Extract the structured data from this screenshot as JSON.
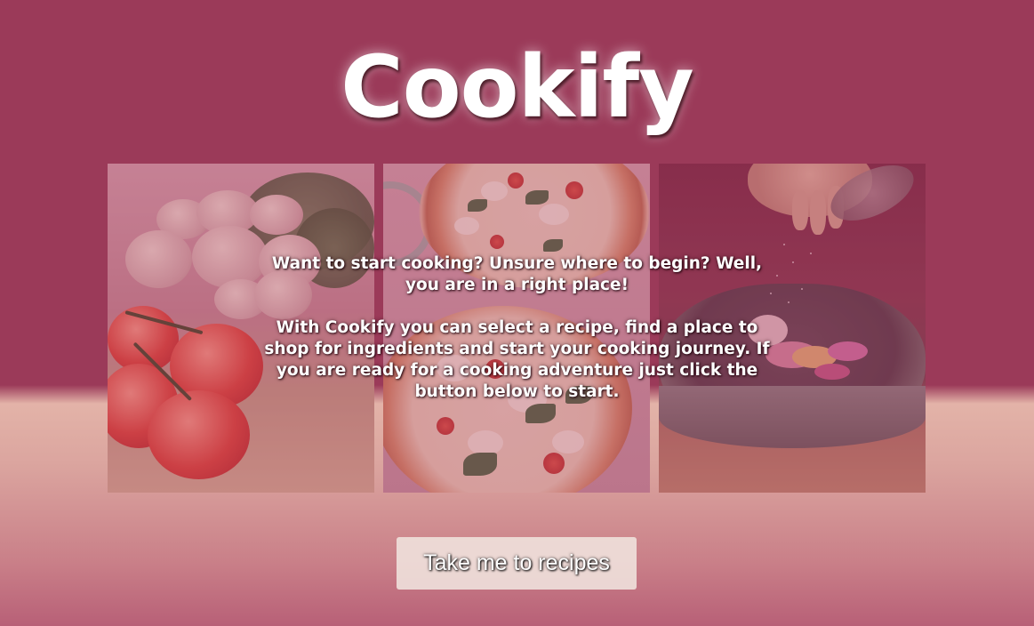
{
  "header": {
    "title": "Cookify"
  },
  "gallery": {
    "images": [
      {
        "subject": "mushrooms-and-tomatoes"
      },
      {
        "subject": "pizzas"
      },
      {
        "subject": "bowl-with-seasoning"
      }
    ]
  },
  "intro": {
    "paragraph1": "Want to start cooking? Unsure where to begin? Well, you are in a right place!",
    "paragraph2": "With Cookify you can select a recipe, find a place to shop for ingredients and start your cooking journey. If you are ready for a cooking adventure just click the button below to start."
  },
  "cta": {
    "label": "Take me to recipes"
  },
  "colors": {
    "background_top": "#9b3a59",
    "background_bottom": "#d9a49f",
    "button_bg": "#efe4de",
    "text": "#ffffff"
  }
}
